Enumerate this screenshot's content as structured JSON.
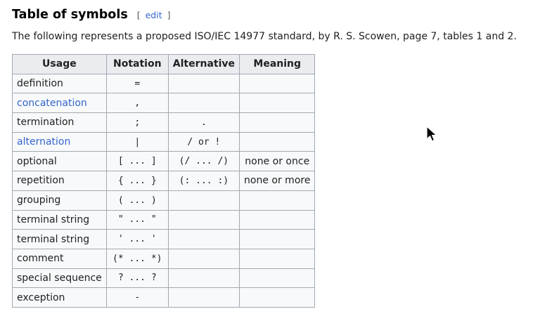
{
  "section": {
    "title": "Table of symbols",
    "edit_open": "[",
    "edit_label": "edit",
    "edit_close": "]"
  },
  "intro": "The following represents a proposed ISO/IEC 14977 standard, by R. S. Scowen, page 7, tables 1 and 2.",
  "table": {
    "headers": {
      "usage": "Usage",
      "notation": "Notation",
      "alternative": "Alternative",
      "meaning": "Meaning"
    },
    "rows": [
      {
        "usage": "definition",
        "usage_is_link": false,
        "notation": "=",
        "alternative": "",
        "meaning": ""
      },
      {
        "usage": "concatenation",
        "usage_is_link": true,
        "notation": ",",
        "alternative": "",
        "meaning": ""
      },
      {
        "usage": "termination",
        "usage_is_link": false,
        "notation": ";",
        "alternative": ".",
        "meaning": ""
      },
      {
        "usage": "alternation",
        "usage_is_link": true,
        "notation": "|",
        "alternative": "/ or !",
        "meaning": ""
      },
      {
        "usage": "optional",
        "usage_is_link": false,
        "notation": "[ ... ]",
        "alternative": "(/ ... /)",
        "meaning": "none or once"
      },
      {
        "usage": "repetition",
        "usage_is_link": false,
        "notation": "{ ... }",
        "alternative": "(: ... :)",
        "meaning": "none or more"
      },
      {
        "usage": "grouping",
        "usage_is_link": false,
        "notation": "( ... )",
        "alternative": "",
        "meaning": ""
      },
      {
        "usage": "terminal string",
        "usage_is_link": false,
        "notation": "\" ... \"",
        "alternative": "",
        "meaning": ""
      },
      {
        "usage": "terminal string",
        "usage_is_link": false,
        "notation": "' ... '",
        "alternative": "",
        "meaning": ""
      },
      {
        "usage": "comment",
        "usage_is_link": false,
        "notation": "(* ... *)",
        "alternative": "",
        "meaning": ""
      },
      {
        "usage": "special sequence",
        "usage_is_link": false,
        "notation": "? ... ?",
        "alternative": "",
        "meaning": ""
      },
      {
        "usage": "exception",
        "usage_is_link": false,
        "notation": "-",
        "alternative": "",
        "meaning": ""
      }
    ]
  },
  "colors": {
    "link": "#3366cc",
    "header_bg": "#eaecf0",
    "cell_bg": "#f8f9fa",
    "border": "#a2a9b1"
  },
  "icons": {
    "cursor": "mouse-pointer-icon"
  }
}
